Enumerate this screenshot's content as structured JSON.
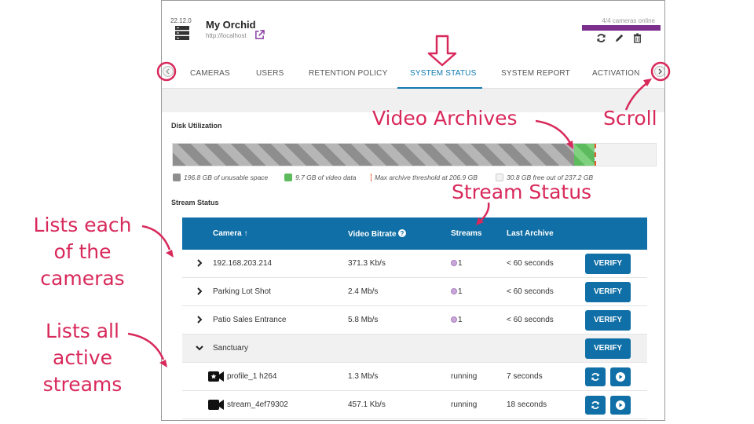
{
  "header": {
    "version": "22.12.0",
    "site_name": "My Orchid",
    "site_url": "http://localhost",
    "cameras_online": "4/4 cameras online",
    "icons": [
      "server-icon",
      "external-link-icon",
      "refresh-icon",
      "pencil-icon",
      "trash-icon"
    ],
    "status_color": "#7b2e8c"
  },
  "tabs": [
    {
      "label": "CAMERAS"
    },
    {
      "label": "USERS"
    },
    {
      "label": "RETENTION POLICY"
    },
    {
      "label": "SYSTEM STATUS",
      "active": true
    },
    {
      "label": "SYSTEM REPORT"
    },
    {
      "label": "ACTIVATION"
    }
  ],
  "disk": {
    "title": "Disk Utilization",
    "unusable_gb": 196.8,
    "video_gb": 9.7,
    "threshold_gb": 206.9,
    "free_gb": 30.8,
    "total_gb": 237.2,
    "legend": {
      "unusable": "196.8 GB of unusable space",
      "video": "9.7 GB of video data",
      "threshold": "Max archive threshold at 206.9 GB",
      "free": "30.8 GB free out of 237.2 GB"
    },
    "colors": {
      "unusable": "#8e8e8e",
      "video": "#5dbb5d",
      "threshold": "#e8552e",
      "free": "#f2f2f2"
    }
  },
  "streams": {
    "title": "Stream Status",
    "columns": {
      "camera": "Camera ↑",
      "bitrate": "Video Bitrate",
      "streams": "Streams",
      "archive": "Last Archive"
    },
    "verify_label": "VERIFY",
    "rows": [
      {
        "camera": "192.168.203.214",
        "bitrate": "371.3 Kb/s",
        "streams": "1",
        "archive": "< 60 seconds"
      },
      {
        "camera": "Parking Lot Shot",
        "bitrate": "2.4 Mb/s",
        "streams": "1",
        "archive": "< 60 seconds"
      },
      {
        "camera": "Patio Sales Entrance",
        "bitrate": "5.8 Mb/s",
        "streams": "1",
        "archive": "< 60 seconds"
      },
      {
        "camera": "Sanctuary",
        "expanded": true
      }
    ],
    "sub_rows": [
      {
        "name": "profile_1 h264",
        "bitrate": "1.3 Mb/s",
        "status": "running",
        "archive": "7 seconds"
      },
      {
        "name": "stream_4ef79302",
        "bitrate": "457.1 Kb/s",
        "status": "running",
        "archive": "18 seconds"
      }
    ],
    "header_color": "#0f6fa6"
  },
  "annotations": {
    "video_archives": "Video Archives",
    "scroll": "Scroll",
    "stream_status": "Stream Status",
    "lists_cameras": [
      "Lists each",
      "of the",
      "cameras"
    ],
    "lists_streams": [
      "Lists all",
      "active",
      "streams"
    ],
    "color": "#d8295b"
  }
}
